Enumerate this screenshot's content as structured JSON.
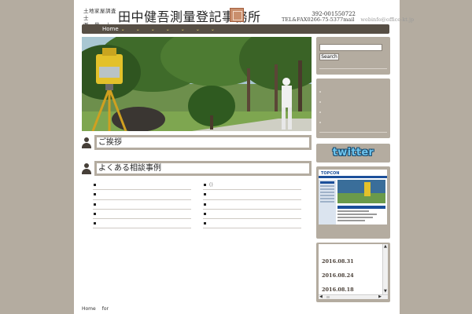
{
  "header": {
    "logo_line1": "土地家屋調査士",
    "logo_line2": "測　量　士",
    "title": "田中健吾測量登記事務所",
    "contact_line1": "392-001550722",
    "contact_line2": "TEL&FAX0266-75-5377mail",
    "contact_mail": "webinfo@office-kt.jp"
  },
  "nav": {
    "home": "Home",
    "chevron": "⌄"
  },
  "sections": {
    "greeting": "ご挨拶",
    "faq": "よくある相談事例"
  },
  "faq_list": {
    "left": [
      "",
      "",
      "",
      "",
      ""
    ],
    "right": [
      "()",
      "",
      "",
      "",
      ""
    ]
  },
  "sidebar": {
    "search_button": "Search",
    "twitter": "twitter",
    "topcon": "TOPCON",
    "news_dates": [
      "2016.08.31",
      "2016.08.24",
      "2016.08.18"
    ]
  },
  "footer": {
    "home": "Home",
    "for": "for"
  },
  "colors": {
    "page_bg": "#b4aca0",
    "nav_bg": "#574f45",
    "nav_chevron": "#e8d870"
  }
}
